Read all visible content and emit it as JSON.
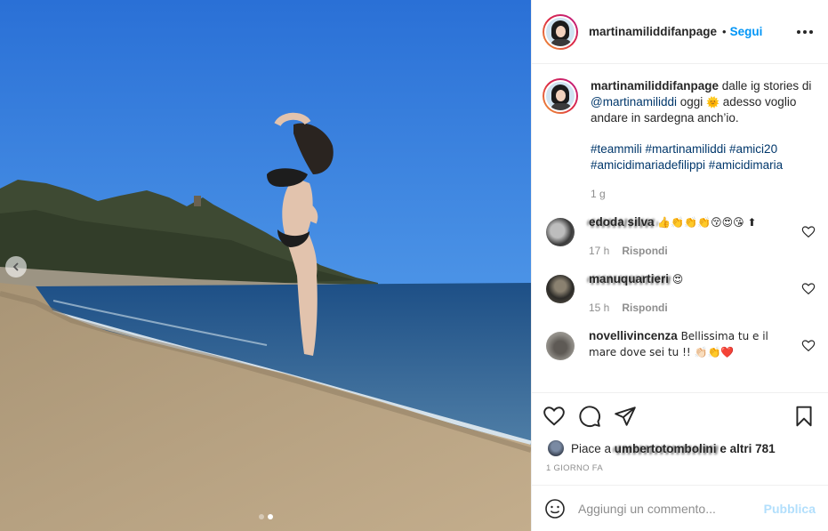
{
  "post": {
    "username": "martinamiliddifanpage",
    "separator": "•",
    "follow_label": "Segui",
    "more_icon": "more-options-icon"
  },
  "caption": {
    "username": "martinamiliddifanpage",
    "text_1": "dalle ig stories di",
    "mention": "@martinamiliddi",
    "text_2": "oggi",
    "emoji": "🌞",
    "text_3": "adesso voglio andare in sardegna anch’io.",
    "hashtags": "#teammili #martinamiliddi #amici20 #amicidimariadefilippi #amicidimaria",
    "time": "1 g"
  },
  "comments": [
    {
      "username": "edoda silva",
      "text": "👍👏👏👏😚😍😘 ⬆",
      "time": "17 h",
      "reply": "Rispondi"
    },
    {
      "username": "manuquartieri",
      "text": "😍",
      "time": "15 h",
      "reply": "Rispondi"
    },
    {
      "username": "novellivincenza",
      "text": "Bellissima tu e il mare dove sei tu !! 👏🏻👏❤️",
      "time": "",
      "reply": ""
    }
  ],
  "likes": {
    "prefix": "Piace a",
    "user": "umbertotombolini",
    "suffix": "e altri 781"
  },
  "date": "1 giorno fa",
  "add_comment": {
    "placeholder": "Aggiungi un commento...",
    "publish_label": "Pubblica"
  },
  "carousel": {
    "index": 2,
    "count": 2
  },
  "colors": {
    "accent": "#0095f6",
    "muted": "#8e8e8e",
    "publish_disabled": "#b2dffc"
  }
}
